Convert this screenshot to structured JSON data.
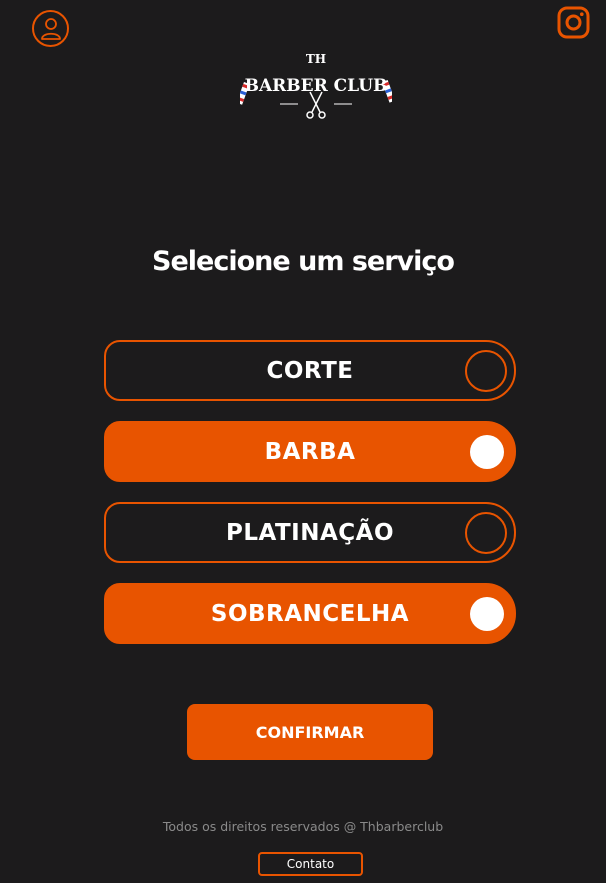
{
  "header": {
    "user_icon": "user-icon",
    "instagram_icon": "instagram-icon"
  },
  "logo": {
    "top_text": "TH",
    "name": "BARBER CLUB"
  },
  "title": "Selecione um serviço",
  "services": [
    {
      "label": "CORTE",
      "selected": false
    },
    {
      "label": "BARBA",
      "selected": true
    },
    {
      "label": "PLATINAÇÃO",
      "selected": false
    },
    {
      "label": "SOBRANCELHA",
      "selected": true
    }
  ],
  "confirm_label": "CONFIRMAR",
  "footer": {
    "copyright": "Todos os direitos reservados @ Thbarberclub",
    "contact_label": "Contato"
  },
  "colors": {
    "accent": "#e85400",
    "background": "#1c1b1c",
    "text": "#ffffff"
  }
}
